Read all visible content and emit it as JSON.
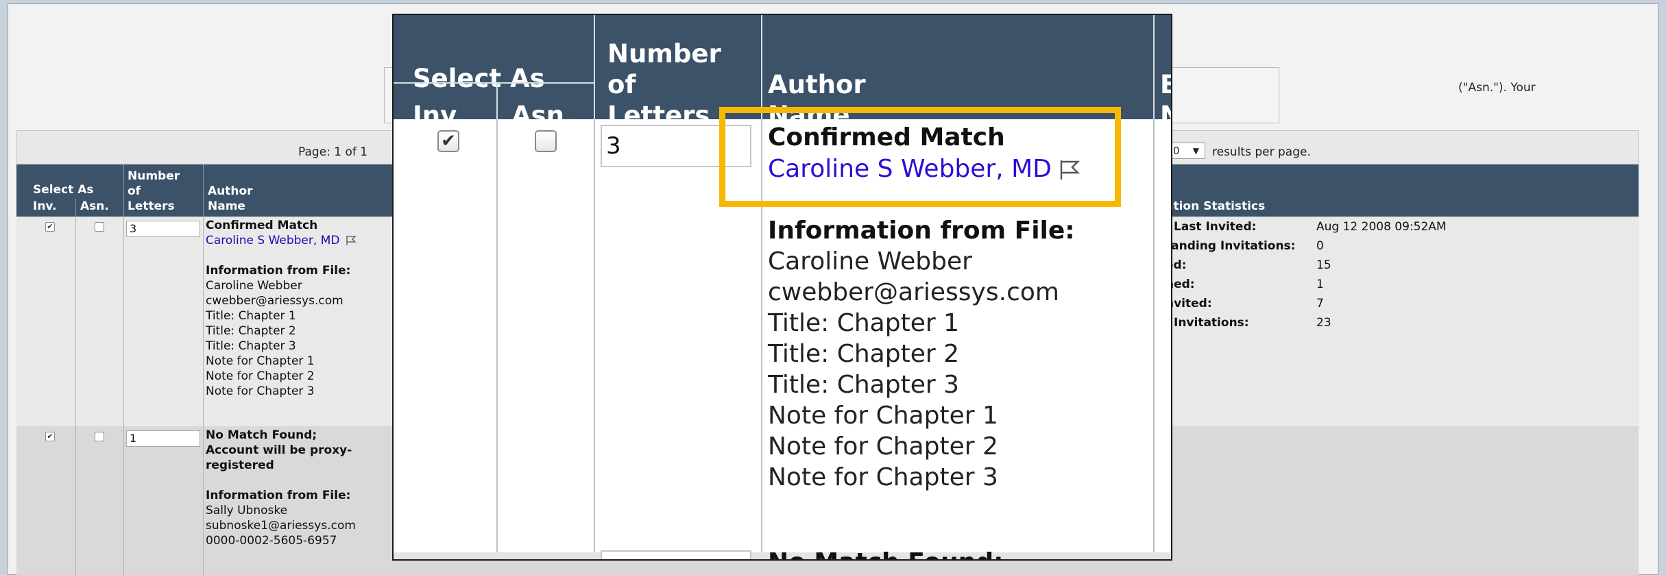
{
  "background": {
    "notice_tail_text": "(\"Asn.\"). Your",
    "pager": {
      "page_count": "Page: 1 of 1",
      "results_per_page_value": "0",
      "results_per_page_label": "results per page."
    },
    "table_header": {
      "select_as": "Select As",
      "inv": "Inv.",
      "asn": "Asn.",
      "number_of_letters": [
        "Number",
        "of",
        "Letters"
      ],
      "author": "Author",
      "name": "Name",
      "invitation_statistics": "ation Statistics"
    },
    "rows": [
      {
        "inv_checked": "✔",
        "asn_checked": "",
        "letters": "3",
        "match_status": "Confirmed Match",
        "author_link": "Caroline S Webber, MD",
        "info_heading": "Information from File:",
        "info_lines": [
          "Caroline Webber",
          "cwebber@ariessys.com",
          "Title: Chapter 1",
          "Title: Chapter 2",
          "Title: Chapter 3",
          "Note for Chapter 1",
          "Note for Chapter 2",
          "Note for Chapter 3"
        ],
        "stats": [
          {
            "label": "Last Invited:",
            "value": "Aug 12 2008 09:52AM"
          },
          {
            "label": "tanding Invitations:",
            "value": "0"
          },
          {
            "label": "ed:",
            "value": "15"
          },
          {
            "label": "ned:",
            "value": "1"
          },
          {
            "label": "nvited:",
            "value": "7"
          },
          {
            "label": "Invitations:",
            "value": "23"
          }
        ]
      },
      {
        "inv_checked": "✔",
        "asn_checked": "",
        "letters": "1",
        "match_status_lines": [
          "No Match Found;",
          "Account will be proxy-",
          "registered"
        ],
        "info_heading": "Information from File:",
        "info_lines": [
          "Sally Ubnoske",
          "subnoske1@ariessys.com",
          "0000-0002-5605-6957"
        ]
      }
    ]
  },
  "zoom": {
    "header": {
      "select_as": "Select As",
      "inv": "Inv.",
      "asn": "Asn.",
      "number_of_letters": [
        "Number",
        "of",
        "Letters"
      ],
      "author_name": [
        "Author",
        "Name"
      ],
      "cut_col": [
        "E",
        "N"
      ]
    },
    "row": {
      "inv_checked": "✔",
      "asn_checked": "",
      "letters": "3",
      "match_status": "Confirmed Match",
      "author_link": "Caroline S Webber, MD",
      "info_heading": "Information from File:",
      "info_lines": [
        "Caroline Webber",
        "cwebber@ariessys.com",
        "Title: Chapter 1",
        "Title: Chapter 2",
        "Title: Chapter 3",
        "Note for Chapter 1",
        "Note for Chapter 2",
        "Note for Chapter 3"
      ],
      "next_row_partial": "No Match Found;"
    },
    "highlight_color": "#f7b900"
  },
  "icons": {
    "flag": "flag-icon",
    "checkbox_check": "checkmark-icon",
    "dropdown_caret": "caret-down-icon"
  }
}
